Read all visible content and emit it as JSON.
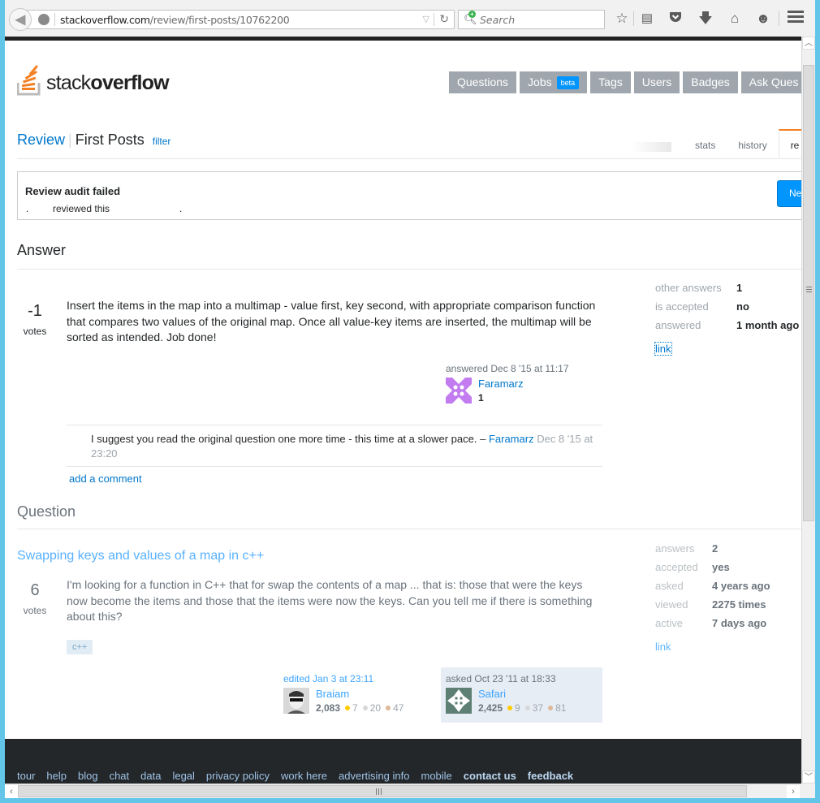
{
  "browser": {
    "url_host": "stackoverflow.com",
    "url_path": "/review/first-posts/10762200",
    "search_placeholder": "Search",
    "toolbar_icons": [
      "bookmark-star-icon",
      "reading-list-icon",
      "pocket-icon",
      "download-icon",
      "home-icon",
      "hello-chat-icon",
      "menu-icon"
    ]
  },
  "site": {
    "logo_light": "stack",
    "logo_bold": "overflow",
    "nav": [
      {
        "label": "Questions"
      },
      {
        "label": "Jobs",
        "badge": "beta"
      },
      {
        "label": "Tags"
      },
      {
        "label": "Users"
      },
      {
        "label": "Badges"
      },
      {
        "label": "Ask Ques"
      }
    ]
  },
  "review": {
    "review_label": "Review",
    "queue_label": "First Posts",
    "filter_label": "filter",
    "tabs": [
      {
        "label": "stats"
      },
      {
        "label": "history"
      },
      {
        "label": "re"
      }
    ]
  },
  "audit": {
    "title": "Review audit failed",
    "subtitle_prefix": ".",
    "subtitle": "reviewed this",
    "subtitle_suffix": ".",
    "next_label": "Ne"
  },
  "answer": {
    "heading": "Answer",
    "votes": "-1",
    "votes_label": "votes",
    "body": "Insert the items in the map into a multimap - value first, key second, with appropriate comparison function that compares two values of the original map. Once all value-key items are inserted, the multimap will be sorted as intended. Job done!",
    "stats": [
      {
        "key": "other answers",
        "value": "1"
      },
      {
        "key": "is accepted",
        "value": "no"
      },
      {
        "key": "answered",
        "value": "1 month ago"
      }
    ],
    "link_label": "link",
    "author": {
      "action": "answered Dec 8 '15 at 11:17",
      "name": "Faramarz",
      "rep": "1"
    },
    "comment": {
      "text": "I suggest you read the original question one more time - this time at a slower pace. –",
      "user": "Faramarz",
      "date": "Dec 8 '15 at 23:20"
    },
    "add_comment_label": "add a comment"
  },
  "question": {
    "heading": "Question",
    "title": "Swapping keys and values of a map in c++",
    "votes": "6",
    "votes_label": "votes",
    "body": "I'm looking for a function in C++ that for swap the contents of a map ... that is: those that were the keys now become the items and those that the items were now the keys. Can you tell me if there is something about this?",
    "tags": [
      "c++"
    ],
    "stats": [
      {
        "key": "answers",
        "value": "2"
      },
      {
        "key": "accepted",
        "value": "yes"
      },
      {
        "key": "asked",
        "value": "4 years ago"
      },
      {
        "key": "viewed",
        "value": "2275 times"
      },
      {
        "key": "active",
        "value": "7 days ago"
      }
    ],
    "link_label": "link",
    "editor": {
      "action": "edited Jan 3 at 23:11",
      "name": "Braiam",
      "rep": "2,083",
      "gold": "7",
      "silver": "20",
      "bronze": "47"
    },
    "owner": {
      "action": "asked Oct 23 '11 at 18:33",
      "name": "Safari",
      "rep": "2,425",
      "gold": "9",
      "silver": "37",
      "bronze": "81"
    }
  },
  "footer": {
    "links": [
      {
        "label": "tour"
      },
      {
        "label": "help"
      },
      {
        "label": "blog"
      },
      {
        "label": "chat"
      },
      {
        "label": "data"
      },
      {
        "label": "legal"
      },
      {
        "label": "privacy policy"
      },
      {
        "label": "work here"
      },
      {
        "label": "advertising info"
      },
      {
        "label": "mobile"
      },
      {
        "label": "contact us",
        "bold": true
      },
      {
        "label": "feedback",
        "bold": true
      }
    ]
  },
  "colors": {
    "accent_link": "#0077cc",
    "nav_bg": "#9fa6ad",
    "primary_button": "#0095ff",
    "logo_orange": "#f48024",
    "footer_bg": "#242729",
    "badge_gold": "#ffcc01",
    "badge_silver": "#b4b8bc",
    "badge_bronze": "#d1a684"
  }
}
